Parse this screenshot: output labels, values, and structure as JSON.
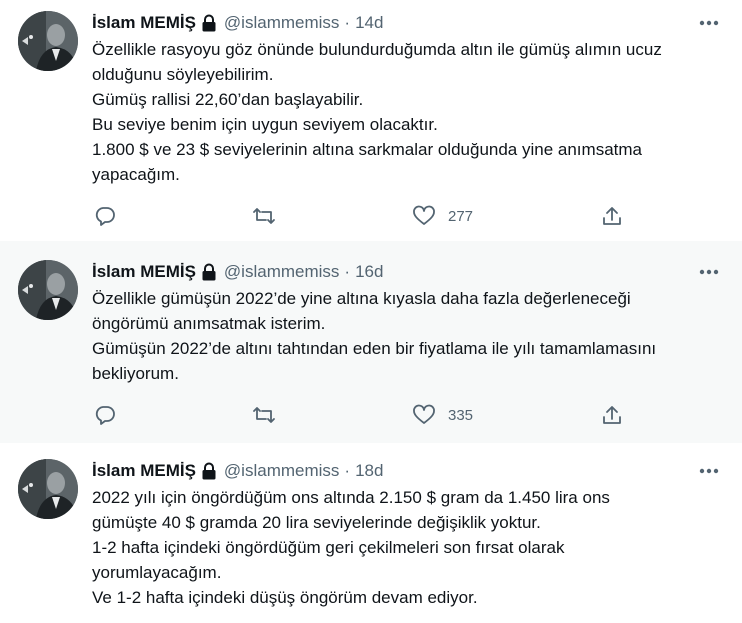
{
  "tweets": [
    {
      "author": {
        "name": "İslam MEMİŞ",
        "handle": "@islammemiss",
        "protected_icon": "lock-icon"
      },
      "separator": "·",
      "time": "14d",
      "lines": [
        "Özellikle rasyoyu göz önünde bulundurduğumda altın ile gümüş alımın ucuz",
        "olduğunu söyleyebilirim.",
        "Gümüş rallisi 22,60’dan başlayabilir.",
        "Bu seviye benim için uygun seviyem olacaktır.",
        "1.800 $ ve 23 $ seviyelerinin altına sarkmalar olduğunda yine anımsatma",
        "yapacağım."
      ],
      "actions": {
        "like_count": "277"
      }
    },
    {
      "author": {
        "name": "İslam MEMİŞ",
        "handle": "@islammemiss",
        "protected_icon": "lock-icon"
      },
      "separator": "·",
      "time": "16d",
      "lines": [
        "Özellikle gümüşün 2022’de yine altına kıyasla daha fazla değerleneceği",
        "öngörümü anımsatmak isterim.",
        "Gümüşün 2022’de altını tahtından eden bir fiyatlama ile yılı tamamlamasını",
        "bekliyorum."
      ],
      "actions": {
        "like_count": "335"
      }
    },
    {
      "author": {
        "name": "İslam MEMİŞ",
        "handle": "@islammemiss",
        "protected_icon": "lock-icon"
      },
      "separator": "·",
      "time": "18d",
      "lines": [
        "2022 yılı için öngördüğüm ons altında 2.150 $ gram da 1.450 lira ons",
        "gümüşte 40 $ gramda 20 lira seviyelerinde değişiklik yoktur.",
        "1-2 hafta içindeki öngördüğüm geri çekilmeleri son fırsat olarak",
        "yorumlayacağım.",
        "Ve 1-2 hafta içindeki düşüş öngörüm devam ediyor."
      ]
    }
  ],
  "colors": {
    "text": "#0f1419",
    "secondary": "#536471",
    "highlight_bg": "#f7f9f9",
    "divider": "#eff3f4"
  }
}
